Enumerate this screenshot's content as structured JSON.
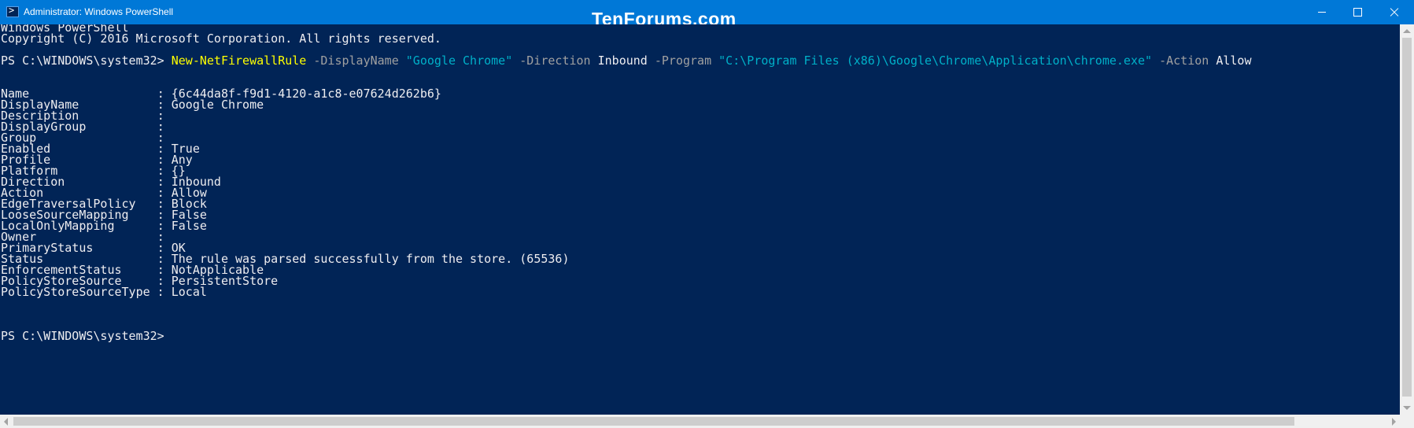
{
  "window": {
    "title": "Administrator: Windows PowerShell",
    "watermark": "TenForums.com",
    "icon": "powershell-icon",
    "controls": [
      "minimize-icon",
      "maximize-icon",
      "close-icon"
    ]
  },
  "console": {
    "header_line1": "Windows PowerShell",
    "header_line2": "Copyright (C) 2016 Microsoft Corporation. All rights reserved.",
    "command": {
      "prompt": "PS C:\\WINDOWS\\system32> ",
      "cmdlet": "New-NetFirewallRule",
      "seg1": " -DisplayName ",
      "seg2": "\"Google Chrome\"",
      "seg3": " -Direction ",
      "seg4": "Inbound",
      "seg5": " -Program ",
      "seg6": "\"C:\\Program Files (x86)\\Google\\Chrome\\Application\\chrome.exe\"",
      "seg7": " -Action ",
      "seg8": "Allow"
    },
    "output": [
      {
        "key": "Name                 ",
        "value": ": {6c44da8f-f9d1-4120-a1c8-e07624d262b6}"
      },
      {
        "key": "DisplayName          ",
        "value": ": Google Chrome"
      },
      {
        "key": "Description          ",
        "value": ":"
      },
      {
        "key": "DisplayGroup         ",
        "value": ":"
      },
      {
        "key": "Group                ",
        "value": ":"
      },
      {
        "key": "Enabled              ",
        "value": ": True"
      },
      {
        "key": "Profile              ",
        "value": ": Any"
      },
      {
        "key": "Platform             ",
        "value": ": {}"
      },
      {
        "key": "Direction            ",
        "value": ": Inbound"
      },
      {
        "key": "Action               ",
        "value": ": Allow"
      },
      {
        "key": "EdgeTraversalPolicy  ",
        "value": ": Block"
      },
      {
        "key": "LooseSourceMapping   ",
        "value": ": False"
      },
      {
        "key": "LocalOnlyMapping     ",
        "value": ": False"
      },
      {
        "key": "Owner                ",
        "value": ":"
      },
      {
        "key": "PrimaryStatus        ",
        "value": ": OK"
      },
      {
        "key": "Status               ",
        "value": ": The rule was parsed successfully from the store. (65536)"
      },
      {
        "key": "EnforcementStatus    ",
        "value": ": NotApplicable"
      },
      {
        "key": "PolicyStoreSource    ",
        "value": ": PersistentStore"
      },
      {
        "key": "PolicyStoreSourceType",
        "value": " : Local"
      }
    ],
    "final_prompt": "PS C:\\WINDOWS\\system32>"
  },
  "colors": {
    "background": "#012456",
    "titlebar": "#0078d7",
    "text": "#eeedf0",
    "cmdlet": "#ffff00",
    "parameter": "#a0a0a0",
    "string": "#00b0c8"
  }
}
